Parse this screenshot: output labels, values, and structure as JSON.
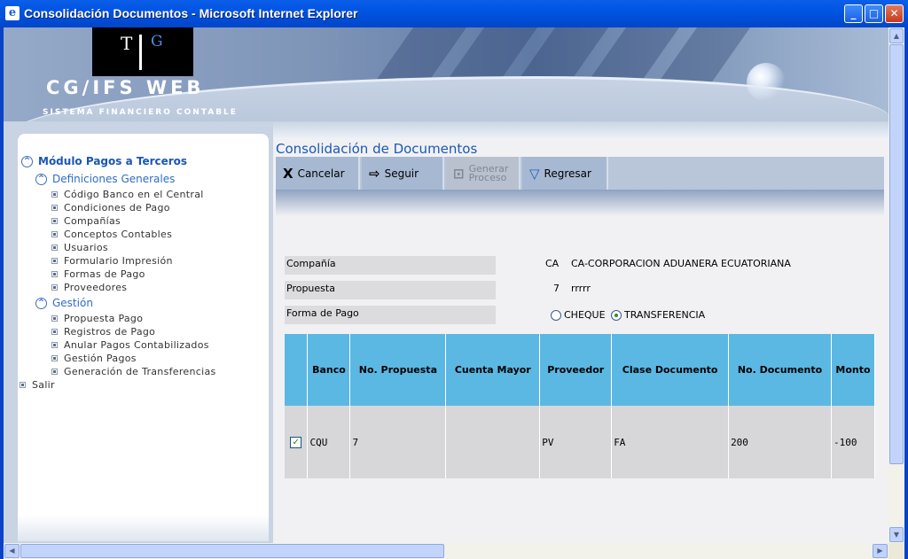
{
  "window": {
    "title": "Consolidación Documentos - Microsoft Internet Explorer",
    "minimize": "_",
    "maximize": "□",
    "close": "✕"
  },
  "banner": {
    "logo_left": "T",
    "logo_right": "G",
    "brand": "CG/IFS  WEB",
    "subtitle": "SISTEMA FINANCIERO CONTABLE"
  },
  "sidebar": {
    "module": "Módulo Pagos a Terceros",
    "groups": [
      {
        "label": "Definiciones Generales",
        "items": [
          "Código Banco en el Central",
          "Condiciones de Pago",
          "Compañías",
          "Conceptos Contables",
          "Usuarios",
          "Formulario Impresión",
          "Formas de Pago",
          "Proveedores"
        ]
      },
      {
        "label": "Gestión",
        "items": [
          "Propuesta Pago",
          "Registros de Pago",
          "Anular Pagos Contabilizados",
          "Gestión Pagos",
          "Generación de Transferencias"
        ]
      }
    ],
    "exit": "Salir"
  },
  "main": {
    "title": "Consolidación de Documentos",
    "toolbar": {
      "cancel": "Cancelar",
      "next": "Seguir",
      "generate_line1": "Generar",
      "generate_line2": "Proceso",
      "back": "Regresar"
    },
    "form": {
      "company_label": "Compañía",
      "company_code": "CA",
      "company_name": "CA-CORPORACION ADUANERA ECUATORIANA",
      "proposal_label": "Propuesta",
      "proposal_number": "7",
      "proposal_name": "rrrrr",
      "payment_label": "Forma de Pago",
      "option_check": "CHEQUE",
      "option_transfer": "TRANSFERENCIA",
      "selected_option": "TRANSFERENCIA"
    },
    "table": {
      "headers": [
        "",
        "Banco",
        "No. Propuesta",
        "Cuenta Mayor",
        "Proveedor",
        "Clase Documento",
        "No. Documento",
        "Monto"
      ],
      "rows": [
        {
          "checked": true,
          "banco": "CQU",
          "propuesta": "7",
          "cuenta": "",
          "proveedor": "PV",
          "clase": "FA",
          "documento": "200",
          "monto": "-100"
        }
      ]
    }
  },
  "colors": {
    "title_blue": "#1b58b6",
    "header_cyan": "#5bb8e3",
    "row_gray": "#d7d7da",
    "toolbar_blue": "#a7b8d2"
  }
}
